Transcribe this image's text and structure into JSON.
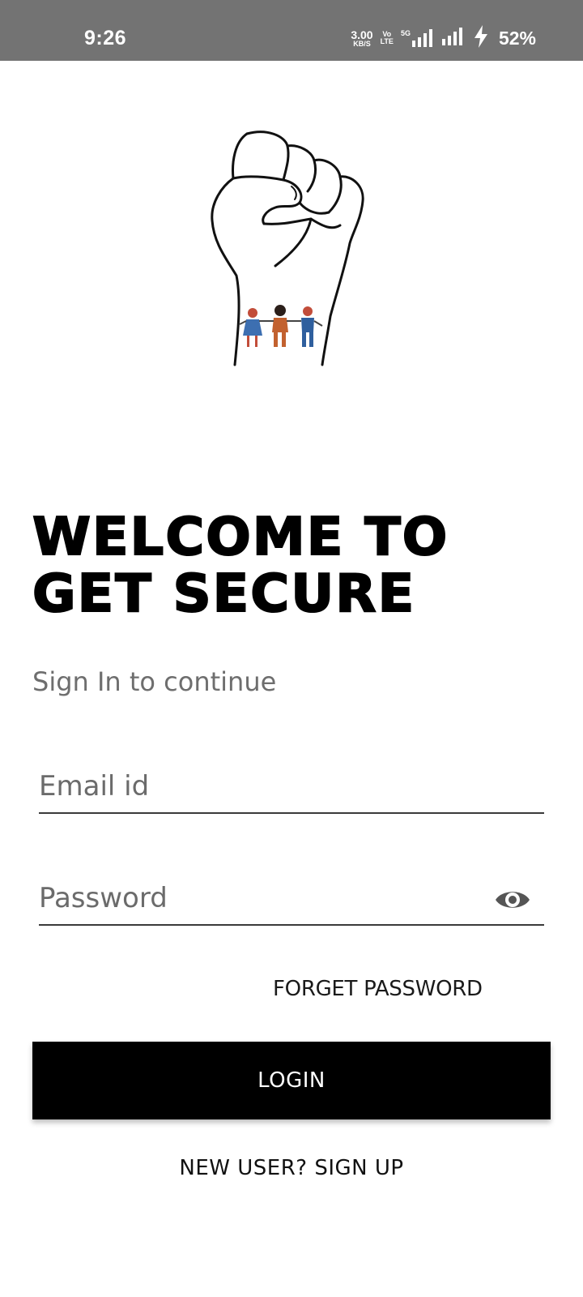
{
  "status_bar": {
    "time": "9:26",
    "net_speed_value": "3.00",
    "net_speed_unit": "KB/S",
    "volte_top": "Vo",
    "volte_bottom": "LTE",
    "network_type": "5G",
    "battery_percent": "52%",
    "icons": [
      "signal-5g-icon",
      "signal-icon",
      "charging-bolt-icon"
    ]
  },
  "logo": {
    "icon": "raised-fist-with-people-icon",
    "colors": {
      "person1": "#3d6fb1",
      "person2": "#c2612f",
      "person3": "#2f5f9e"
    }
  },
  "welcome": {
    "title": "WELCOME TO GET SECURE",
    "subtitle": "Sign In to continue"
  },
  "form": {
    "email_placeholder": "Email id",
    "password_placeholder": "Password",
    "password_toggle_icon": "eye-icon",
    "forget_password_label": "FORGET PASSWORD",
    "login_label": "LOGIN",
    "signup_label": "NEW USER? SIGN UP"
  },
  "colors": {
    "status_bar_bg": "#737373",
    "button_bg": "#000000",
    "button_text": "#ffffff",
    "underline": "#3a3a3a"
  }
}
